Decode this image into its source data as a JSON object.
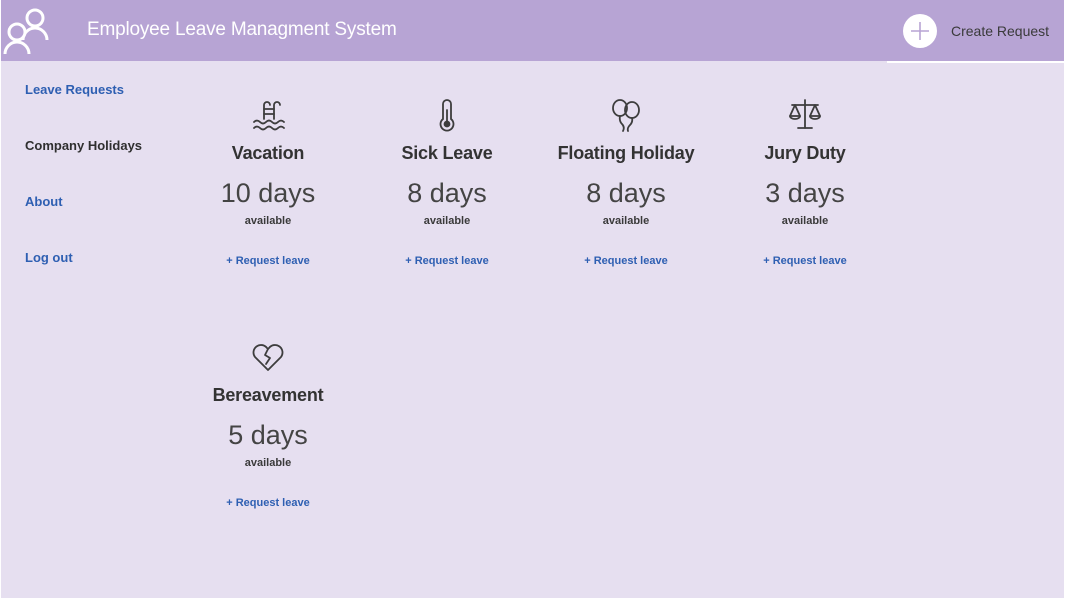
{
  "header": {
    "title": "Employee Leave Managment System",
    "create_label": "Create Request",
    "logo_icon": "users-icon",
    "create_icon": "plus-icon"
  },
  "colors": {
    "header_bg": "#b7a4d4",
    "page_bg": "#e6dff0",
    "link": "#2e5fb2",
    "text": "#333333"
  },
  "sidebar": {
    "items": [
      {
        "label": "Leave Requests",
        "current": false
      },
      {
        "label": "Company Holidays",
        "current": true
      },
      {
        "label": "About",
        "current": false
      },
      {
        "label": "Log out",
        "current": false
      }
    ]
  },
  "leave_types": [
    {
      "icon": "swimming-pool-icon",
      "title": "Vacation",
      "days": "10 days",
      "available": "available",
      "plus": "+",
      "link": "Request leave"
    },
    {
      "icon": "thermometer-icon",
      "title": "Sick Leave",
      "days": "8 days",
      "available": "available",
      "plus": "+",
      "link": "Request leave"
    },
    {
      "icon": "balloons-icon",
      "title": "Floating Holiday",
      "days": "8 days",
      "available": "available",
      "plus": "+",
      "link": "Request leave"
    },
    {
      "icon": "scales-icon",
      "title": "Jury Duty",
      "days": "3 days",
      "available": "available",
      "plus": "+",
      "link": "Request leave"
    },
    {
      "icon": "broken-heart-icon",
      "title": "Bereavement",
      "days": "5 days",
      "available": "available",
      "plus": "+",
      "link": "Request leave"
    }
  ]
}
